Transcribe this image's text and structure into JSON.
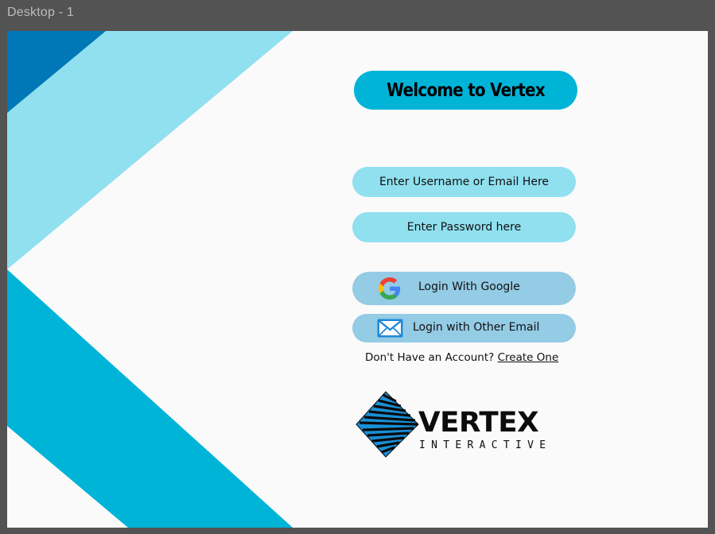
{
  "window": {
    "title": "Desktop - 1"
  },
  "header": {
    "welcome": "Welcome to Vertex"
  },
  "form": {
    "username_placeholder": "Enter Username or Email Here",
    "password_placeholder": "Enter Password here"
  },
  "buttons": {
    "google_label": "Login With Google",
    "email_label": "Login with Other Email"
  },
  "signup": {
    "prompt": "Don't Have an Account?",
    "link": "Create One"
  },
  "logo": {
    "word": "VERTEX",
    "sub": "INTERACTIVE"
  },
  "colors": {
    "dark_blue": "#0077b6",
    "mid_blue": "#00b4d8",
    "light_blue": "#90e0ef",
    "button_blue": "#94cbe5"
  },
  "icons": [
    "google-icon",
    "mail-icon"
  ]
}
